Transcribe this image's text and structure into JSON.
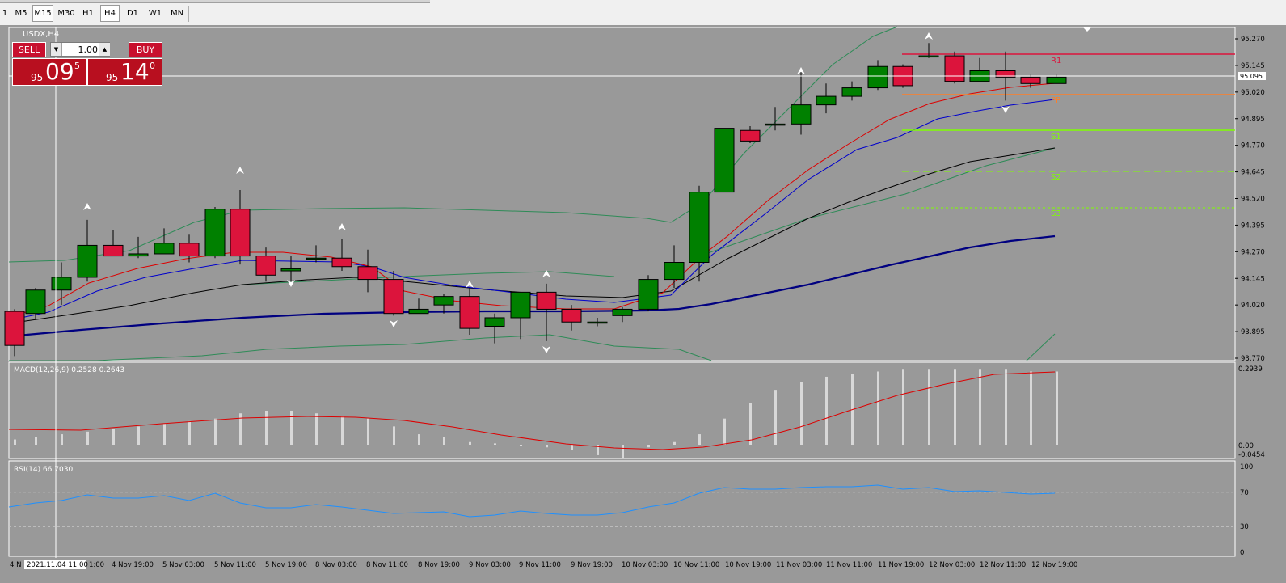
{
  "timeframes": [
    "1",
    "M5",
    "M15",
    "M30",
    "H1",
    "H4",
    "D1",
    "W1",
    "MN"
  ],
  "active_timeframe": "H4",
  "chart": {
    "symbol_title": "USDX,H4",
    "current_price_label": "95.095",
    "price_labels": [
      "95.270",
      "95.145",
      "95.020",
      "94.895",
      "94.770",
      "94.645",
      "94.520",
      "94.395",
      "94.270",
      "94.145",
      "94.020",
      "93.895",
      "93.770"
    ],
    "time_labels": [
      "4 N",
      "2021.11.04 11:00",
      "1:00",
      "4 Nov 19:00",
      "5 Nov 03:00",
      "5 Nov 11:00",
      "5 Nov 19:00",
      "8 Nov 03:00",
      "8 Nov 11:00",
      "8 Nov 19:00",
      "9 Nov 03:00",
      "9 Nov 11:00",
      "9 Nov 19:00",
      "10 Nov 03:00",
      "10 Nov 11:00",
      "10 Nov 19:00",
      "11 Nov 03:00",
      "11 Nov 11:00",
      "11 Nov 19:00",
      "12 Nov 03:00",
      "12 Nov 11:00",
      "12 Nov 19:00"
    ],
    "pivot_labels": {
      "r1": "R1",
      "pp": "PP",
      "s1": "S1",
      "s2": "S2",
      "s3": "S3"
    },
    "colors": {
      "bg": "#999999",
      "bull": "#008000",
      "bear": "#dc143c",
      "grid": "#a8a8a8",
      "r1": "#dc143c",
      "pp": "#ff7f27",
      "s": "#7fff00"
    }
  },
  "trade_panel": {
    "sell_label": "SELL",
    "buy_label": "BUY",
    "lot_value": "1.00",
    "sell_price": {
      "prefix": "95",
      "main": "09",
      "sup": "5"
    },
    "buy_price": {
      "prefix": "95",
      "main": "14",
      "sup": "0"
    }
  },
  "macd": {
    "label": "MACD(12,26,9) 0.2528 0.2643",
    "scale_labels": [
      "0.2939",
      "0.00",
      "-0.0454"
    ]
  },
  "rsi": {
    "label": "RSI(14) 66.7030",
    "scale_labels": [
      "100",
      "70",
      "30",
      "0"
    ]
  }
}
